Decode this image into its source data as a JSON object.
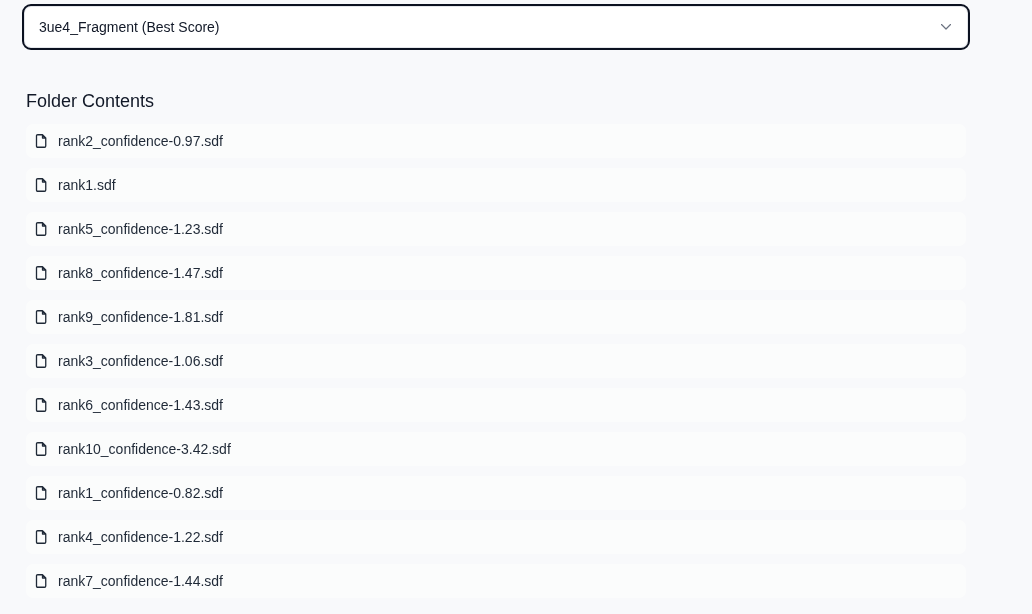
{
  "dropdown": {
    "value": "3ue4_Fragment (Best Score)",
    "focused": true
  },
  "folder": {
    "title": "Folder Contents",
    "files": [
      {
        "name": "rank2_confidence-0.97.sdf"
      },
      {
        "name": "rank1.sdf"
      },
      {
        "name": "rank5_confidence-1.23.sdf"
      },
      {
        "name": "rank8_confidence-1.47.sdf"
      },
      {
        "name": "rank9_confidence-1.81.sdf"
      },
      {
        "name": "rank3_confidence-1.06.sdf"
      },
      {
        "name": "rank6_confidence-1.43.sdf"
      },
      {
        "name": "rank10_confidence-3.42.sdf"
      },
      {
        "name": "rank1_confidence-0.82.sdf"
      },
      {
        "name": "rank4_confidence-1.22.sdf"
      },
      {
        "name": "rank7_confidence-1.44.sdf"
      }
    ]
  }
}
